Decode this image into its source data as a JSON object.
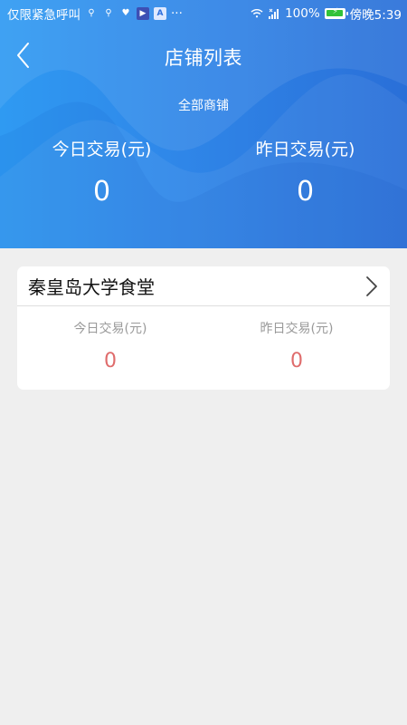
{
  "status_bar": {
    "carrier": "仅限紧急呼叫",
    "extra_indicator": "···",
    "battery_percent": "100%",
    "time": "傍晚5:39",
    "battery_level": 100,
    "app_badges": [
      "▶",
      "A"
    ]
  },
  "header": {
    "title": "店铺列表",
    "scope_label": "全部商铺",
    "today_label": "今日交易(元)",
    "today_value": "0",
    "yesterday_label": "昨日交易(元)",
    "yesterday_value": "0",
    "back_icon": "chevron-left-icon"
  },
  "shops": [
    {
      "name": "秦皇岛大学食堂",
      "today_label": "今日交易(元)",
      "today_value": "0",
      "yesterday_label": "昨日交易(元)",
      "yesterday_value": "0",
      "chevron_icon": "chevron-right-icon"
    }
  ],
  "colors": {
    "header_start": "#2f9af2",
    "header_end": "#2a6fd8",
    "page_background": "#efefef",
    "value_red": "#df6c6c",
    "battery_green": "#31c23a"
  }
}
